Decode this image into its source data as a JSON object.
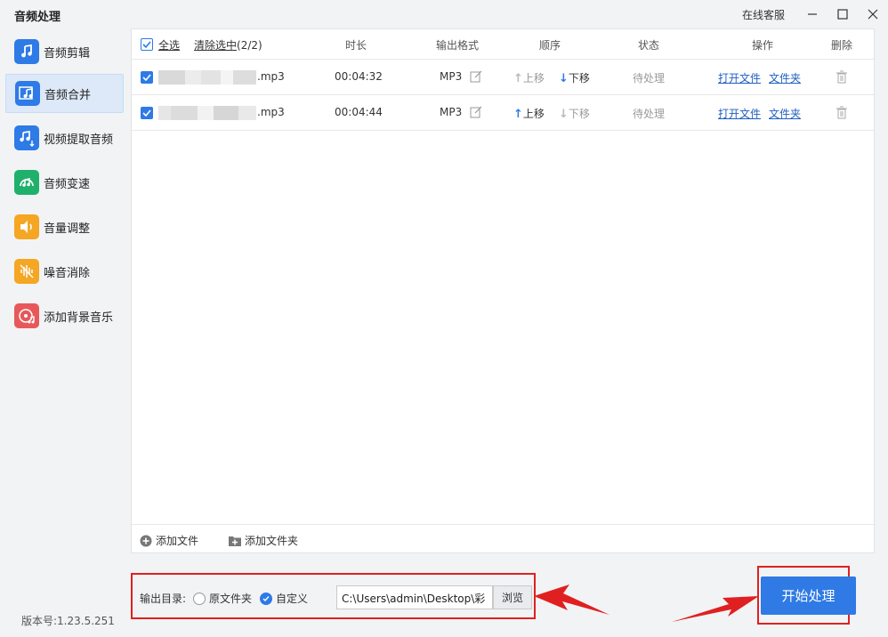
{
  "app": {
    "title": "音频处理",
    "version": "版本号:1.23.5.251"
  },
  "window": {
    "service": "在线客服",
    "minimize": "—",
    "maximize": "☐",
    "close": "✕"
  },
  "sidebar": {
    "items": [
      {
        "label": "音频剪辑",
        "icon": "audio-cut-icon",
        "color": "#2e7ae6",
        "active": false
      },
      {
        "label": "音频合并",
        "icon": "audio-merge-icon",
        "color": "#2e7ae6",
        "active": true
      },
      {
        "label": "视频提取音频",
        "icon": "video-extract-audio-icon",
        "color": "#2e7ae6",
        "active": false
      },
      {
        "label": "音频变速",
        "icon": "audio-speed-icon",
        "color": "#1fb16c",
        "active": false
      },
      {
        "label": "音量调整",
        "icon": "volume-icon",
        "color": "#f5a623",
        "active": false
      },
      {
        "label": "噪音消除",
        "icon": "noise-reduce-icon",
        "color": "#f5a623",
        "active": false
      },
      {
        "label": "添加背景音乐",
        "icon": "background-music-icon",
        "color": "#e8585a",
        "active": false
      }
    ]
  },
  "table": {
    "headers": {
      "select_all": "全选",
      "clear_selected": "清除选中",
      "selected_count": "(2/2)",
      "duration": "时长",
      "format": "输出格式",
      "order": "顺序",
      "status": "状态",
      "action": "操作",
      "delete": "删除"
    },
    "rows": [
      {
        "name": ".mp3",
        "duration": "00:04:32",
        "format": "MP3",
        "up": "上移",
        "down": "下移",
        "status": "待处理",
        "open_file": "打开文件",
        "open_folder": "文件夹"
      },
      {
        "name": ".mp3",
        "duration": "00:04:44",
        "format": "MP3",
        "up": "上移",
        "down": "下移",
        "status": "待处理",
        "open_file": "打开文件",
        "open_folder": "文件夹"
      }
    ]
  },
  "footer": {
    "add_file": "添加文件",
    "add_folder": "添加文件夹"
  },
  "output": {
    "label": "输出目录:",
    "option_original": "原文件夹",
    "option_custom": "自定义",
    "path": "C:\\Users\\admin\\Desktop\\彩",
    "browse": "浏览"
  },
  "start_button": "开始处理",
  "colors": {
    "accent": "#2e7ae6",
    "annotation": "#e02020"
  }
}
